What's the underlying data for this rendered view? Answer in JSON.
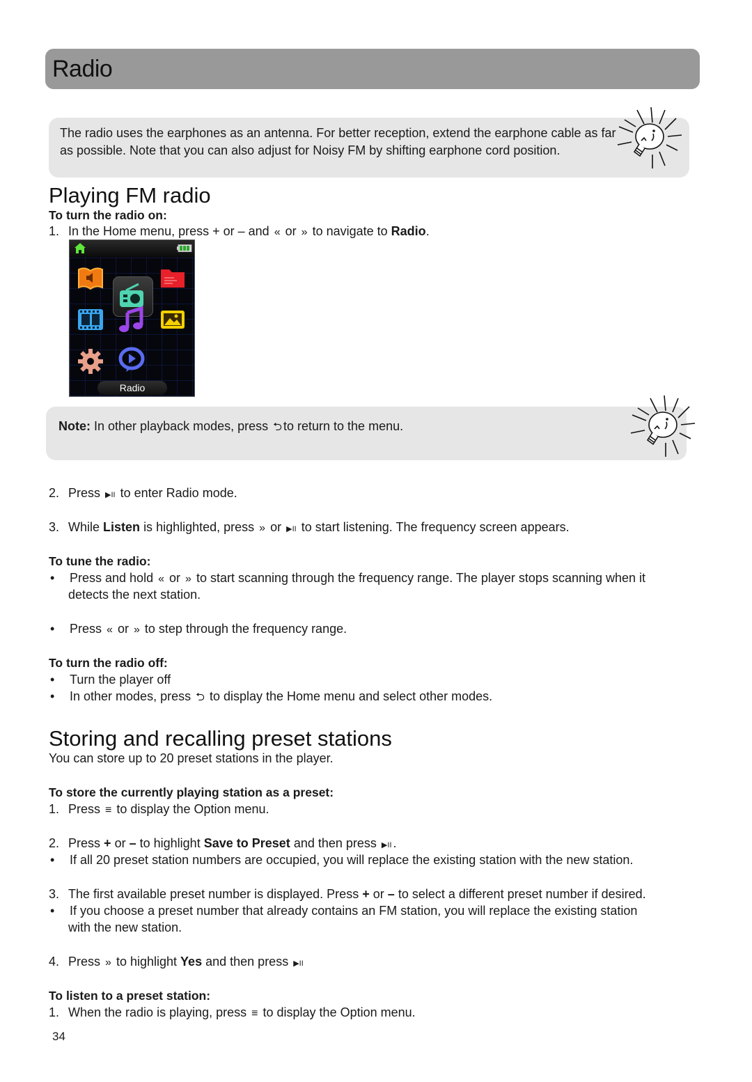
{
  "page": {
    "title": "Radio",
    "page_number": "34"
  },
  "tip_top": {
    "text": "The radio uses the earphones as an antenna. For better reception, extend the earphone cable as far as possible. Note that you can also adjust for Noisy FM by shifting earphone cord position.",
    "icon": "lightbulb-icon"
  },
  "playing": {
    "heading": "Playing FM radio",
    "turn_on": {
      "subheading": "To turn the radio on:",
      "step1": {
        "num": "1.",
        "pre": "In the Home menu, press + or – and",
        "mid": "or",
        "post": "to navigate to",
        "bold": "Radio",
        "end": "."
      },
      "screen": {
        "label": "Radio",
        "selected_app": "radio",
        "apps": [
          "audiobooks",
          "radio",
          "folders",
          "video",
          "music",
          "photos",
          "settings",
          "internet-video"
        ]
      },
      "note": {
        "label": "Note:",
        "pre": "In other playback modes, press",
        "post": "to return to the menu."
      },
      "step2": {
        "num": "2.",
        "pre": "Press",
        "post": "to enter Radio mode."
      },
      "step3": {
        "num": "3.",
        "pre": "While",
        "bold": "Listen",
        "mid": "is highlighted, press",
        "or": "or",
        "post": "to start listening. The frequency screen appears."
      }
    },
    "tune": {
      "subheading": "To tune the radio:",
      "b1": {
        "pre": "Press and hold",
        "or": "or",
        "post": "to start scanning through the frequency range. The player stops scanning when it",
        "cont": "detects the next station."
      },
      "b2": {
        "pre": "Press",
        "or": "or",
        "post": "to step through the frequency range."
      }
    },
    "turn_off": {
      "subheading": "To turn the radio off:",
      "b1": "Turn the player off",
      "b2": {
        "pre": "In other modes, press",
        "post": "to display the Home menu and select other modes."
      }
    }
  },
  "presets": {
    "heading": "Storing and recalling preset stations",
    "intro": "You can store up to 20 preset stations in the player.",
    "store": {
      "subheading": "To store the currently playing station as a preset:",
      "step1": {
        "num": "1.",
        "pre": "Press",
        "post": "to display the Option menu."
      },
      "step2": {
        "num": "2.",
        "pre": "Press",
        "plus": "+",
        "or": "or",
        "minus": "–",
        "mid": "to highlight",
        "bold": "Save to Preset",
        "post": "and then press",
        "end": "."
      },
      "b1": "If all 20 preset station numbers are occupied, you will replace the existing station with the new station.",
      "step3": {
        "num": "3.",
        "pre": "The first available preset number is displayed. Press",
        "plus": "+",
        "or": "or",
        "minus": "–",
        "post": "to select a different preset number if desired."
      },
      "b2": {
        "text": "If you choose a preset number that already contains an FM station, you will replace the existing station",
        "cont": "with the new station."
      },
      "step4": {
        "num": "4.",
        "pre": "Press",
        "mid": "to highlight",
        "bold": "Yes",
        "post": "and then press"
      }
    },
    "listen": {
      "subheading": "To listen to a preset station:",
      "step1": {
        "num": "1.",
        "pre": "When the radio is playing, press",
        "post": "to display the Option menu."
      }
    }
  },
  "glyphs": {
    "prev": "«",
    "next": "»",
    "play_pause": "▶II",
    "back": "⮌",
    "menu": "≡",
    "bullet": "•"
  },
  "colors": {
    "title_bar": "#999999",
    "tip_box": "#e6e6e6"
  }
}
